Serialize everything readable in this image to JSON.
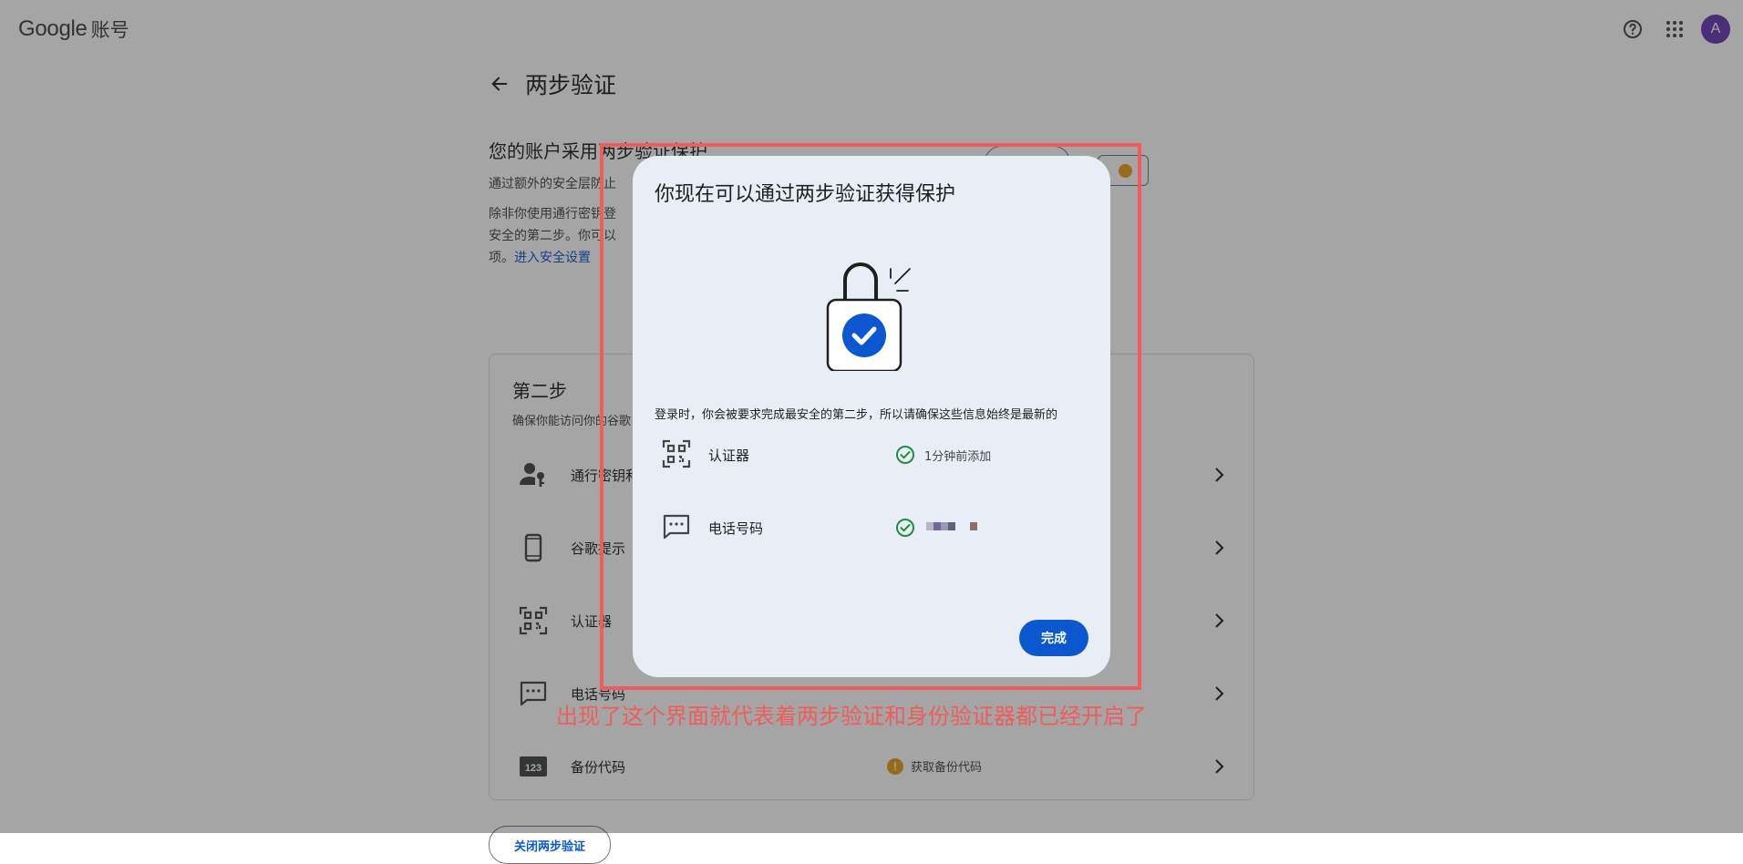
{
  "header": {
    "brand_google": "Google",
    "brand_product": "账号",
    "help_icon": "help-circle-icon",
    "apps_icon": "apps-grid-icon",
    "avatar_letter": "A",
    "avatar_color": "#673ab7"
  },
  "page": {
    "title": "两步验证",
    "back_icon": "arrow-back-icon"
  },
  "protection": {
    "heading": "您的账户采用两步验证保护",
    "description": "通过额外的安全层防止",
    "paragraph_start": "除非你使用通行密钥登",
    "paragraph_line2": "安全的第二步。你可以",
    "paragraph_line3_prefix": "项。",
    "settings_link": "进入安全设置"
  },
  "second_step": {
    "title": "第二步",
    "subtitle": "确保你能访问你的谷歌",
    "rows": [
      {
        "label": "通行密钥和",
        "icon": "passkey-person-icon",
        "status": ""
      },
      {
        "label": "谷歌提示",
        "icon": "smartphone-icon",
        "status": ""
      },
      {
        "label": "认证器",
        "icon": "authenticator-qr-icon",
        "status": ""
      },
      {
        "label": "电话号码",
        "icon": "sms-message-icon",
        "status": ""
      },
      {
        "label": "备份代码",
        "icon": "backup-codes-123-icon",
        "status": "获取备份代码",
        "status_icon": "warning-icon"
      }
    ]
  },
  "turn_off_button": "关闭两步验证",
  "dialog": {
    "title": "你现在可以通过两步验证获得保护",
    "illustration": "lock-check-icon",
    "description": "登录时，你会被要求完成最安全的第二步，所以请确保这些信息始终是最新的",
    "methods": [
      {
        "label": "认证器",
        "icon": "authenticator-qr-icon",
        "status": "1分钟前添加",
        "status_icon": "check-circle-icon"
      },
      {
        "label": "电话号码",
        "icon": "sms-message-icon",
        "status": "",
        "status_icon": "check-circle-icon"
      }
    ],
    "done_button": "完成"
  },
  "annotation": {
    "text": "出现了这个界面就代表着两步验证和身份验证器都已经开启了",
    "color": "#f05c5c"
  },
  "colors": {
    "accent": "#0b57d0",
    "success": "#1e8e3e",
    "warning": "#e6a11a"
  }
}
